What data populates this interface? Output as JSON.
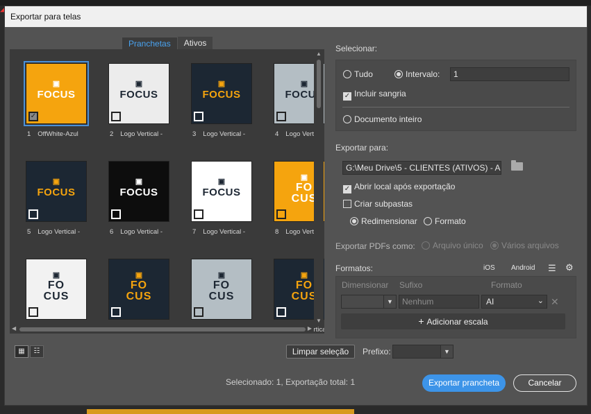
{
  "dialog": {
    "title": "Exportar para telas"
  },
  "tabs": [
    {
      "label": "Pranchetas",
      "active": true
    },
    {
      "label": "Ativos",
      "active": false
    }
  ],
  "boards": [
    {
      "num": "1",
      "name": "OffWhite-Azul",
      "bg": "#f5a40e",
      "fg": "#ffffff",
      "logo": "FOCUS",
      "stacked": false,
      "checked": true
    },
    {
      "num": "2",
      "name": "Logo Vertical -",
      "bg": "#ececec",
      "fg": "#1d2733",
      "logo": "FOCUS",
      "stacked": false,
      "checked": false
    },
    {
      "num": "3",
      "name": "Logo Vertical -",
      "bg": "#1c2733",
      "fg": "#f5a40e",
      "logo": "FOCUS",
      "stacked": false,
      "checked": false
    },
    {
      "num": "4",
      "name": "Logo Vertical -",
      "bg": "#b4bec4",
      "fg": "#1d2733",
      "logo": "FOCUS",
      "stacked": false,
      "checked": false
    },
    {
      "num": "5",
      "name": "Logo Vertical -",
      "bg": "#1c2733",
      "fg": "#f5a40e",
      "logo": "FOCUS",
      "stacked": false,
      "checked": false
    },
    {
      "num": "6",
      "name": "Logo Vertical -",
      "bg": "#0d0d0d",
      "fg": "#ffffff",
      "logo": "FOCUS",
      "stacked": false,
      "checked": false
    },
    {
      "num": "7",
      "name": "Logo Vertical -",
      "bg": "#ffffff",
      "fg": "#1d2733",
      "logo": "FOCUS",
      "stacked": false,
      "checked": false
    },
    {
      "num": "8",
      "name": "Logo Vertical -",
      "bg": "#f5a40e",
      "fg": "#ffffff",
      "logo": "FOCUS",
      "stacked": true,
      "checked": false
    },
    {
      "num": "9",
      "name": "Logo Vertical -",
      "bg": "#f2f2f2",
      "fg": "#1d2733",
      "logo": "FOCUS",
      "stacked": true,
      "checked": false
    },
    {
      "num": "10",
      "name": "Logo Vertical -",
      "bg": "#1c2733",
      "fg": "#f5a40e",
      "logo": "FOCUS",
      "stacked": true,
      "checked": false
    },
    {
      "num": "11",
      "name": "Logo Vertical -",
      "bg": "#b4bec4",
      "fg": "#1d2733",
      "logo": "FOCUS",
      "stacked": true,
      "checked": false
    },
    {
      "num": "12",
      "name": "Logo Vertical -",
      "bg": "#1c2733",
      "fg": "#f5a40e",
      "logo": "FOCUS",
      "stacked": true,
      "checked": false
    }
  ],
  "select": {
    "label": "Selecionar:",
    "all": "Tudo",
    "range": "Intervalo:",
    "range_value": "1",
    "bleed": "Incluir sangria",
    "whole_doc": "Documento inteiro"
  },
  "export_to": {
    "label": "Exportar para:",
    "path": "G:\\Meu Drive\\5 - CLIENTES (ATIVOS) - A",
    "open_after": "Abrir local após exportação",
    "subfolders": "Criar subpastas",
    "resize": "Redimensionar",
    "format": "Formato"
  },
  "pdf": {
    "label": "Exportar PDFs como:",
    "single": "Arquivo único",
    "multi": "Vários arquivos"
  },
  "formats": {
    "label": "Formatos:",
    "ios": "iOS",
    "android": "Android",
    "col_dim": "Dimensionar",
    "col_suffix": "Sufixo",
    "col_format": "Formato",
    "suffix_placeholder": "Nenhum",
    "format_value": "AI",
    "add_scale": "Adicionar escala"
  },
  "footer": {
    "clear": "Limpar seleção",
    "prefix": "Prefixo:",
    "status": "Selecionado: 1, Exportação total: 1",
    "export": "Exportar prancheta",
    "cancel": "Cancelar"
  }
}
